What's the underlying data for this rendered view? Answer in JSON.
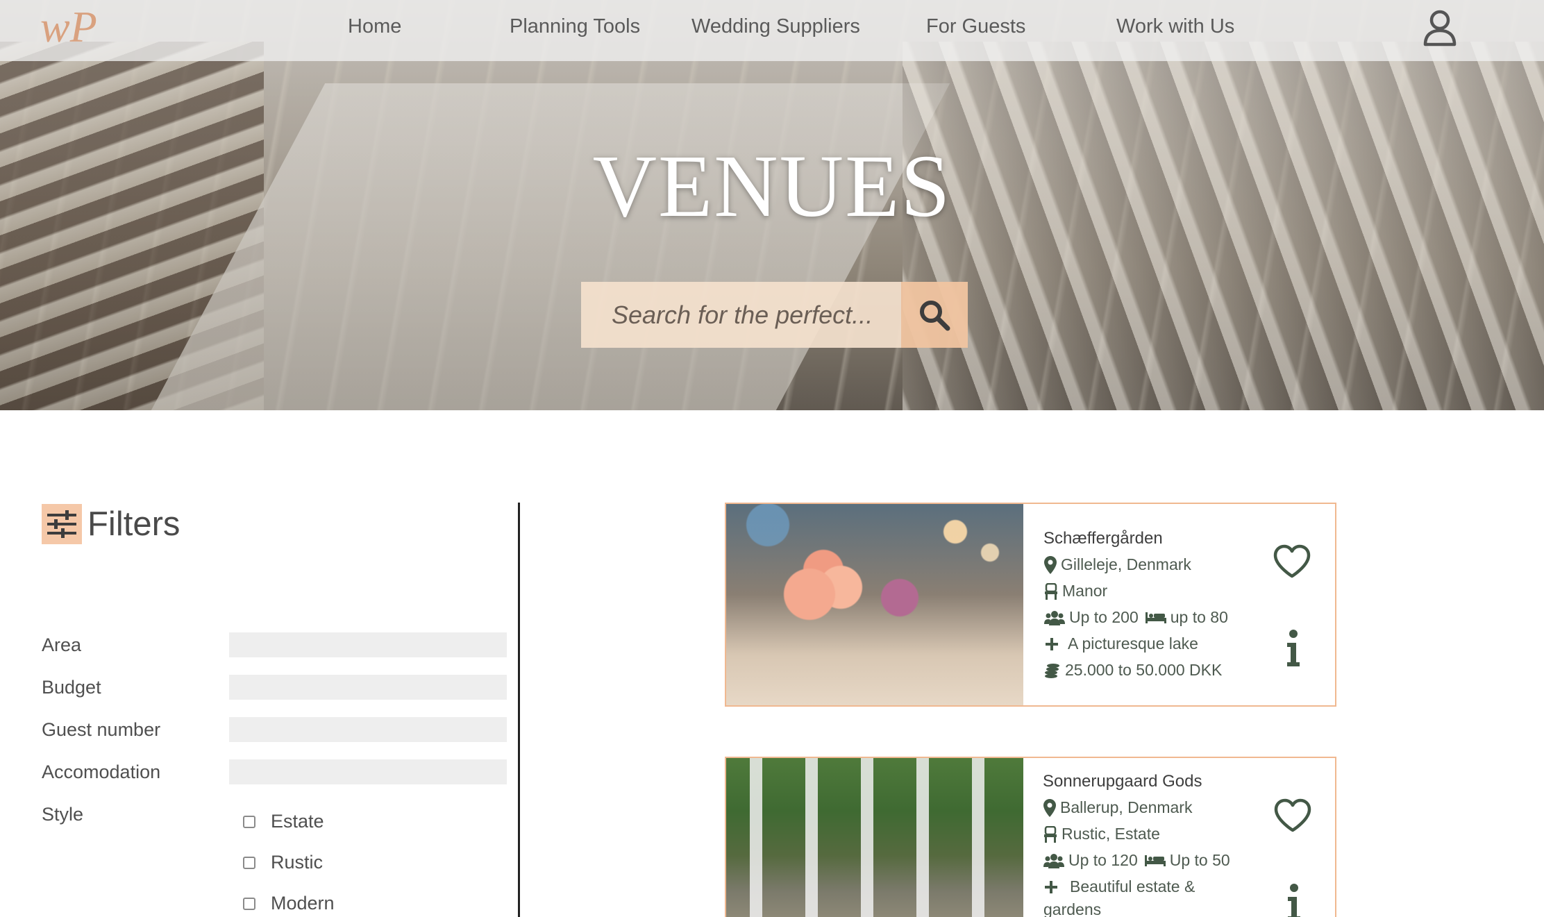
{
  "nav": {
    "logo_text": "wP",
    "items": [
      "Home",
      "Planning Tools",
      "Wedding Suppliers",
      "For Guests",
      "Work with Us"
    ]
  },
  "hero": {
    "title": "VENUES",
    "search_placeholder": "Search for the perfect..."
  },
  "filters": {
    "title": "Filters",
    "labels": [
      "Area",
      "Budget",
      "Guest number",
      "Accomodation",
      "Style"
    ],
    "style_options": [
      "Estate",
      "Rustic",
      "Modern"
    ]
  },
  "venues": [
    {
      "name": "Schæffergården",
      "location": "Gilleleje, Denmark",
      "type": "Manor",
      "guests": "Up to 200",
      "beds": "up to 80",
      "feature": "A picturesque lake",
      "price": "25.000 to 50.000 DKK"
    },
    {
      "name": "Sonnerupgaard Gods",
      "location": "Ballerup, Denmark",
      "type": "Rustic, Estate",
      "guests": "Up to 120",
      "beds": "Up to 50",
      "feature": "Beautiful estate &",
      "feature_cont": "gardens"
    }
  ],
  "colors": {
    "accent": "#f0b890",
    "accent_strong": "#f5c8a8",
    "icon_green": "#435846",
    "text": "#4a4a4a"
  }
}
